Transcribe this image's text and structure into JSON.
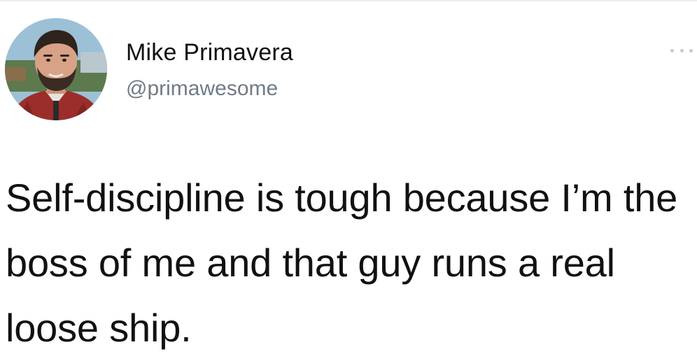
{
  "author": {
    "display_name": "Mike Primavera",
    "handle": "@primawesome"
  },
  "tweet": {
    "text": "Self-discipline is tough because I’m the boss of me and that guy runs a real loose ship."
  },
  "icons": {
    "more": "more-dots-icon",
    "avatar": "profile-photo"
  },
  "colors": {
    "text": "#111111",
    "handle": "#6f7b85",
    "background": "#ffffff"
  }
}
